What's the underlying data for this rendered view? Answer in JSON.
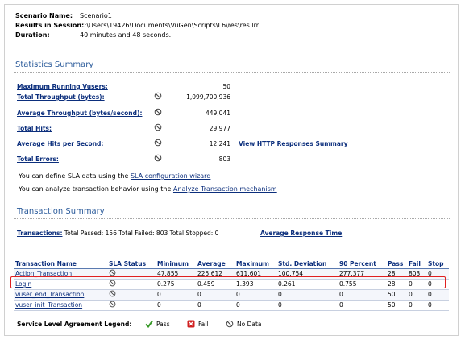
{
  "scenario": {
    "name_label": "Scenario Name:",
    "name_value": "Scenario1",
    "results_label": "Results in Session:",
    "results_value": "C:\\Users\\19426\\Documents\\VuGen\\Scripts\\L6\\res\\res.lrr",
    "duration_label": "Duration:",
    "duration_value": "40 minutes and 48 seconds."
  },
  "statistics": {
    "heading": "Statistics Summary",
    "max_vusers_label": "Maximum Running Vusers:",
    "max_vusers_value": "50",
    "total_throughput_label": "Total Throughput (bytes):",
    "total_throughput_value": "1,099,700,936",
    "avg_throughput_label": "Average Throughput (bytes/second):",
    "avg_throughput_value": "449,041",
    "total_hits_label": "Total Hits:",
    "total_hits_value": "29,977",
    "avg_hits_label": "Average Hits per Second:",
    "avg_hits_value": "12.241",
    "view_http_link": "View HTTP Responses Summary",
    "total_errors_label": "Total Errors:",
    "total_errors_value": "803",
    "sla_text_prefix": "You can define SLA data using the ",
    "sla_link": "SLA configuration wizard",
    "analyze_text_prefix": "You can analyze transaction behavior using the ",
    "analyze_link": "Analyze Transaction mechanism"
  },
  "transaction_summary": {
    "heading": "Transaction Summary",
    "transactions_label": "Transactions:",
    "transactions_text": " Total Passed: 156 Total Failed: 803 Total Stopped: 0",
    "avg_response_link": "Average Response Time",
    "columns": [
      "Transaction Name",
      "SLA Status",
      "Minimum",
      "Average",
      "Maximum",
      "Std. Deviation",
      "90 Percent",
      "Pass",
      "Fail",
      "Stop"
    ],
    "rows": [
      {
        "name": "Action_Transaction",
        "minimum": "47.855",
        "average": "225.612",
        "maximum": "611.601",
        "std": "100.754",
        "p90": "277.377",
        "pass": "28",
        "fail": "803",
        "stop": "0"
      },
      {
        "name": "Login",
        "minimum": "0.275",
        "average": "0.459",
        "maximum": "1.393",
        "std": "0.261",
        "p90": "0.755",
        "pass": "28",
        "fail": "0",
        "stop": "0"
      },
      {
        "name": "vuser_end_Transaction",
        "minimum": "0",
        "average": "0",
        "maximum": "0",
        "std": "0",
        "p90": "0",
        "pass": "50",
        "fail": "0",
        "stop": "0"
      },
      {
        "name": "vuser_init_Transaction",
        "minimum": "0",
        "average": "0",
        "maximum": "0",
        "std": "0",
        "p90": "0",
        "pass": "50",
        "fail": "0",
        "stop": "0"
      }
    ]
  },
  "legend": {
    "label": "Service Level Agreement Legend:",
    "pass": "Pass",
    "fail": "Fail",
    "nodata": "No Data"
  },
  "colors": {
    "heading": "#2a5a9a",
    "link": "#0b2e7c",
    "highlight": "#e02020",
    "pass": "#3a9a2a",
    "fail": "#d02020"
  },
  "icons": [
    "no-data-icon",
    "pass-check-icon",
    "fail-x-icon"
  ]
}
